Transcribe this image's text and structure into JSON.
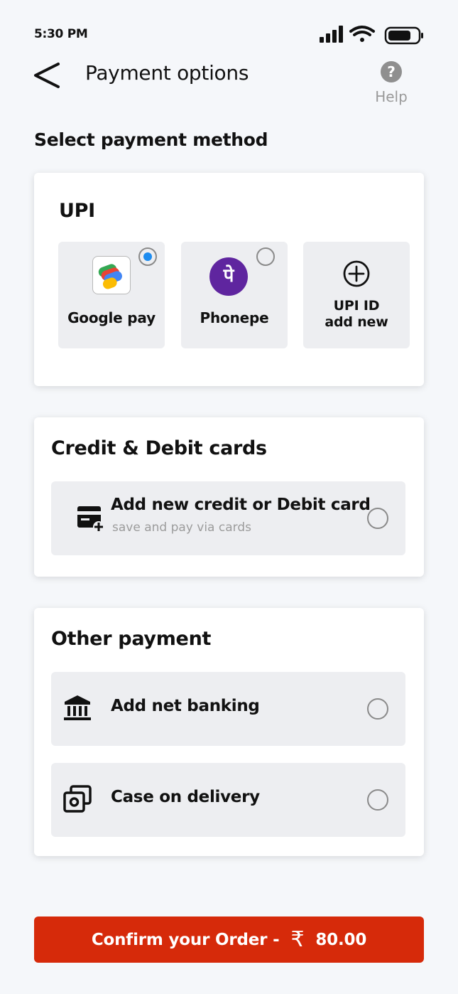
{
  "status_bar": {
    "time": "5:30 PM"
  },
  "header": {
    "title": "Payment options",
    "help_label": "Help",
    "help_glyph": "?"
  },
  "section_heading": "Select payment method",
  "upi": {
    "title": "UPI",
    "options": [
      {
        "label": "Google pay",
        "selected": true
      },
      {
        "label": "Phonepe",
        "selected": false
      },
      {
        "label_line1": "UPI ID",
        "label_line2": "add new",
        "icon": "plus-circle-icon"
      }
    ],
    "phonepe_glyph": "पे"
  },
  "cards": {
    "title": "Credit & Debit cards",
    "option": {
      "title": "Add new credit or Debit card",
      "subtitle": "save and pay via cards",
      "selected": false
    }
  },
  "other": {
    "title": "Other payment",
    "options": [
      {
        "title": "Add net banking",
        "icon": "bank-icon",
        "selected": false
      },
      {
        "title": "Case on delivery",
        "icon": "cash-icon",
        "selected": false
      }
    ]
  },
  "confirm": {
    "label": "Confirm your Order -",
    "currency": "₹",
    "amount": "80.00"
  },
  "colors": {
    "accent": "#d62a0a",
    "radio_selected": "#1d8cf0",
    "phonepe": "#5f259f",
    "background": "#f5f7fa"
  }
}
